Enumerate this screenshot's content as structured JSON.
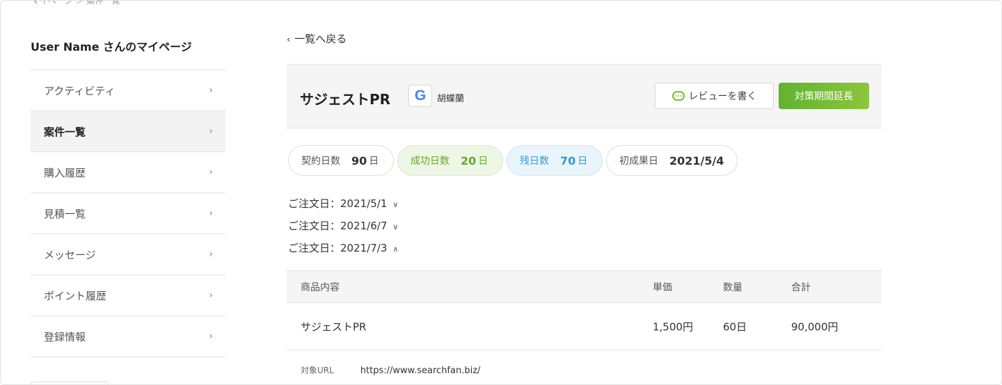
{
  "page": {
    "top_breadcrumb": "マイページ ＞ 案件一覧"
  },
  "sidebar": {
    "user_title": "User Name さんのマイページ",
    "items": [
      {
        "label": "アクティビティ",
        "active": false
      },
      {
        "label": "案件一覧",
        "active": true
      },
      {
        "label": "購入履歴",
        "active": false
      },
      {
        "label": "見積一覧",
        "active": false
      },
      {
        "label": "メッセージ",
        "active": false
      },
      {
        "label": "ポイント履歴",
        "active": false
      },
      {
        "label": "登録情報",
        "active": false
      }
    ],
    "chevron": "›"
  },
  "main": {
    "back_label": "一覧へ戻る",
    "back_icon": "‹",
    "product_title": "サジェストPR",
    "engine_icon": "google-g-icon",
    "engine_letter": "G",
    "keyword": "胡蝶蘭",
    "review_label": "レビューを書く",
    "extend_label": "対策期間延長",
    "stats": {
      "contract": {
        "label": "契約日数",
        "value": "90",
        "unit": "日"
      },
      "success": {
        "label": "成功日数",
        "value": "20",
        "unit": "日"
      },
      "remain": {
        "label": "残日数",
        "value": "70",
        "unit": "日"
      },
      "first": {
        "label": "初成果日",
        "value": "2021/5/4"
      }
    },
    "orders": [
      {
        "label": "ご注文日：2021/5/1",
        "caret": "∨",
        "expanded": false
      },
      {
        "label": "ご注文日：2021/6/7",
        "caret": "∨",
        "expanded": false
      },
      {
        "label": "ご注文日：2021/7/3",
        "caret": "∧",
        "expanded": true
      }
    ],
    "table": {
      "headers": [
        "商品内容",
        "単価",
        "数量",
        "合計"
      ],
      "rows": [
        [
          "サジェストPR",
          "1,500円",
          "60日",
          "90,000円"
        ]
      ],
      "url_label": "対象URL",
      "url_value": "https://www.searchfan.biz/"
    }
  },
  "colors": {
    "accent_green": "#7cbd2b",
    "success_text": "#62ab28",
    "remain_text": "#2e9bd6",
    "google_blue": "#4285F4"
  }
}
